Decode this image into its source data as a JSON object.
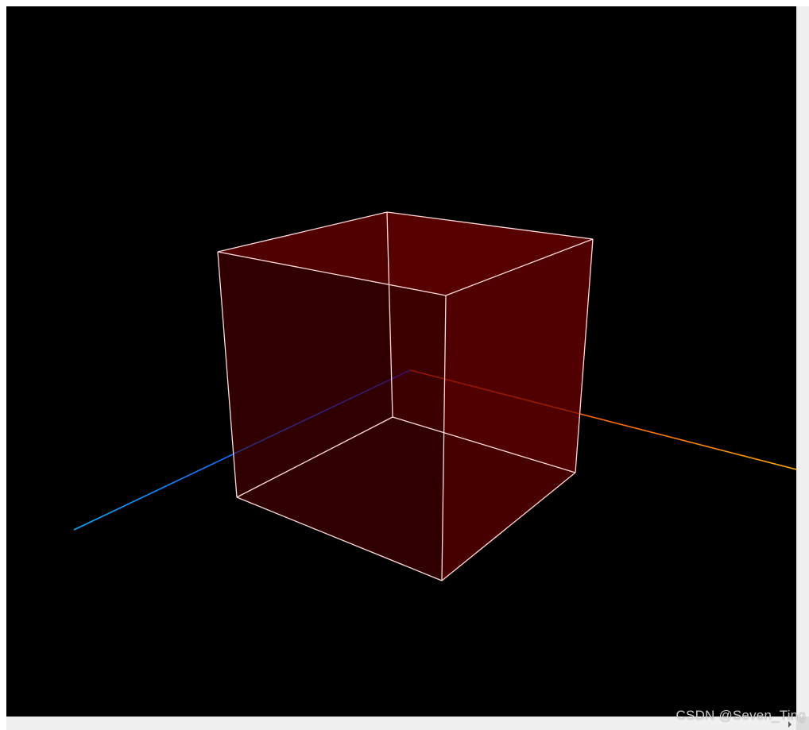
{
  "scene": {
    "background_color": "#000000",
    "axes": {
      "x_color_start": "#ff2a1a",
      "x_color_end": "#ffaa00",
      "y_color_start": "#44aa00",
      "y_color_end": "#aaff00",
      "z_color_start": "#1a40ff",
      "z_color_end": "#00aaff"
    },
    "cube": {
      "edge_color": "#ffd6d6",
      "face_colors": {
        "back": "#400000",
        "floor": "#2a0000",
        "left": "#2a0000",
        "right": "#480000",
        "top": "#560000",
        "front": "#400000"
      }
    }
  },
  "watermark": {
    "text": "CSDN @Seven_Ting"
  },
  "scrollbars": {
    "vertical": "vertical-scrollbar",
    "horizontal": "horizontal-scrollbar"
  }
}
